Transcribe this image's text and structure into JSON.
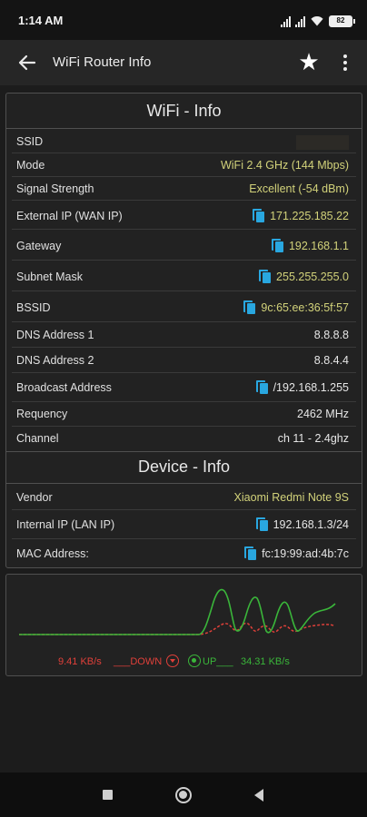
{
  "status_bar": {
    "time": "1:14 AM",
    "battery": "82"
  },
  "app_bar": {
    "title": "WiFi Router Info"
  },
  "wifi_info": {
    "header": "WiFi - Info",
    "rows": [
      {
        "label": "SSID",
        "value": ""
      },
      {
        "label": "Mode",
        "value": "WiFi 2.4 GHz (144 Mbps)"
      },
      {
        "label": "Signal Strength",
        "value": "Excellent (-54 dBm)"
      },
      {
        "label": "External IP (WAN IP)",
        "value": "171.225.185.22"
      },
      {
        "label": "Gateway",
        "value": "192.168.1.1"
      },
      {
        "label": "Subnet Mask",
        "value": "255.255.255.0"
      },
      {
        "label": "BSSID",
        "value": "9c:65:ee:36:5f:57"
      },
      {
        "label": "DNS Address 1",
        "value": "8.8.8.8"
      },
      {
        "label": "DNS Address 2",
        "value": "8.8.4.4"
      },
      {
        "label": "Broadcast Address",
        "value": "/192.168.1.255"
      },
      {
        "label": "Requency",
        "value": "2462 MHz"
      },
      {
        "label": "Channel",
        "value": "ch 11 - 2.4ghz"
      }
    ]
  },
  "device_info": {
    "header": "Device - Info",
    "rows": [
      {
        "label": "Vendor",
        "value": "Xiaomi Redmi Note 9S"
      },
      {
        "label": "Internal IP (LAN IP)",
        "value": "192.168.1.3/24"
      },
      {
        "label": "MAC Address:",
        "value": "fc:19:99:ad:4b:7c"
      }
    ]
  },
  "traffic": {
    "down_speed": "9.41 KB/s",
    "down_label": "___DOWN",
    "up_label": "UP___",
    "up_speed": "34.31 KB/s",
    "colors": {
      "down": "#e0403a",
      "up": "#3ab53a"
    }
  }
}
